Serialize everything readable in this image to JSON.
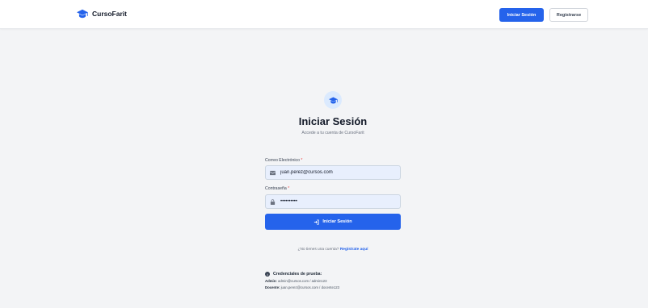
{
  "nav": {
    "brand": "CursoFarit",
    "login_button": "Iniciar Sesión",
    "register_button": "Registrarse"
  },
  "header": {
    "title": "Iniciar Sesión",
    "subtitle": "Accede a tu cuenta de CursoFarit"
  },
  "form": {
    "email_label": "Correo Electrónico",
    "email_value": "juan.perez@cursos.com",
    "password_label": "Contraseña",
    "password_value": "••••••••••",
    "required_mark": "*",
    "submit_label": "Iniciar Sesión"
  },
  "register": {
    "prompt": "¿No tienes una cuenta?",
    "link": "Regístrate aquí"
  },
  "credentials": {
    "title": "Credenciales de prueba:",
    "admin_label": "Admin:",
    "admin_value": "admin@cursos.com / admin123",
    "teacher_label": "Docente:",
    "teacher_value": "juan.perez@cursos.com / docente123"
  },
  "colors": {
    "primary": "#2563eb",
    "background": "#f3f4f6",
    "input_fill": "#e8effd"
  },
  "icons": {
    "brand": "graduation-cap-icon",
    "email": "envelope-icon",
    "password": "lock-icon",
    "submit": "sign-in-icon",
    "info": "info-icon"
  }
}
